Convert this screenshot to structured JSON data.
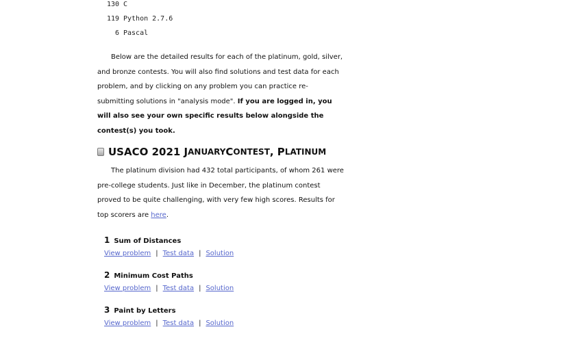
{
  "languages": [
    {
      "count": "130",
      "name": "C"
    },
    {
      "count": "119",
      "name": "Python 2.7.6"
    },
    {
      "count": "6",
      "name": "Pascal"
    }
  ],
  "intro": {
    "text": "Below are the detailed results for each of the platinum, gold, silver, and bronze contests. You will also find solutions and test data for each problem, and by clicking on any problem you can practice re-submitting solutions in \"analysis mode\".",
    "bold": "If you are logged in, you will also see your own specific results below alongside the contest(s) you took."
  },
  "section": {
    "title_main": "USACO 2021 J",
    "title_sc1": "ANUARY",
    "title_c": " C",
    "title_sc2": "ONTEST",
    "title_comma": ", P",
    "title_sc3": "LATINUM",
    "desc": "The platinum division had 432 total participants, of whom 261 were pre-college students. Just like in December, the platinum contest proved to be quite challenging, with very few high scores. Results for top scorers are ",
    "desc_link": "here",
    "desc_end": ".",
    "medal_icon": "platinum-medal-icon"
  },
  "problems": [
    {
      "num": "1",
      "title": "Sum of Distances",
      "view": "View problem",
      "test": "Test data",
      "solution": "Solution",
      "sep": "|"
    },
    {
      "num": "2",
      "title": "Minimum Cost Paths",
      "view": "View problem",
      "test": "Test data",
      "solution": "Solution",
      "sep": "|"
    },
    {
      "num": "3",
      "title": "Paint by Letters",
      "view": "View problem",
      "test": "Test data",
      "solution": "Solution",
      "sep": "|"
    }
  ],
  "colors": {
    "link": "#5566cc",
    "text": "#111111"
  }
}
